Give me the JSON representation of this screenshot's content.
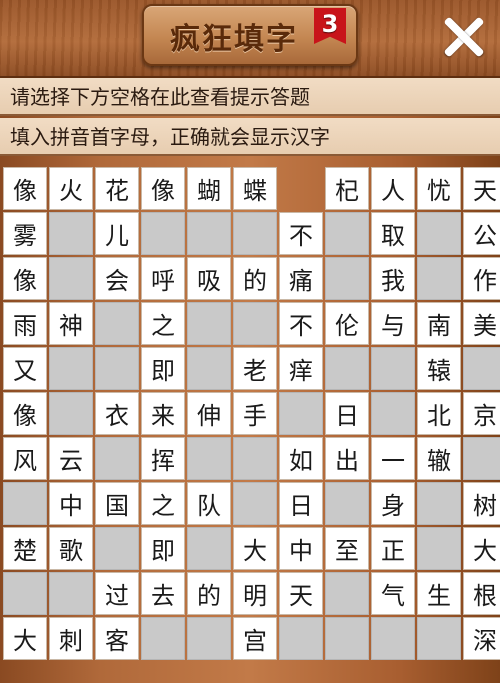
{
  "header": {
    "title": "疯狂填字",
    "level": "3",
    "close_icon": "close-icon"
  },
  "hints": {
    "line1": "请选择下方空格在此查看提示答题",
    "line2": "填入拼音首字母，正确就会显示汉字"
  },
  "colors": {
    "wood": "#b0693a",
    "plate": "#d9a677",
    "badge": "#c8141a",
    "hint_bg": "#f1dcc4",
    "empty_cell": "#c9c9c9"
  },
  "grid": [
    [
      "像",
      "火",
      "花",
      "像",
      "蝴",
      "蝶",
      "#",
      "杞",
      "人",
      "忧",
      "天"
    ],
    [
      "雾",
      "_",
      "儿",
      "_",
      "_",
      "_",
      "不",
      "_",
      "取",
      "_",
      "公"
    ],
    [
      "像",
      "_",
      "会",
      "呼",
      "吸",
      "的",
      "痛",
      "_",
      "我",
      "_",
      "作"
    ],
    [
      "雨",
      "神",
      "_",
      "之",
      "_",
      "_",
      "不",
      "伦",
      "与",
      "南",
      "美"
    ],
    [
      "又",
      "_",
      "_",
      "即",
      "_",
      "老",
      "痒",
      "_",
      "_",
      "辕",
      "_"
    ],
    [
      "像",
      "_",
      "衣",
      "来",
      "伸",
      "手",
      "_",
      "日",
      "_",
      "北",
      "京"
    ],
    [
      "风",
      "云",
      "_",
      "挥",
      "_",
      "_",
      "如",
      "出",
      "一",
      "辙",
      "_"
    ],
    [
      "_",
      "中",
      "国",
      "之",
      "队",
      "_",
      "日",
      "_",
      "身",
      "_",
      "树"
    ],
    [
      "楚",
      "歌",
      "_",
      "即",
      "_",
      "大",
      "中",
      "至",
      "正",
      "_",
      "大"
    ],
    [
      "_",
      "_",
      "过",
      "去",
      "的",
      "明",
      "天",
      "_",
      "气",
      "生",
      "根"
    ],
    [
      "大",
      "刺",
      "客",
      "_",
      "_",
      "宫",
      "_",
      "_",
      "_",
      "_",
      "深"
    ]
  ]
}
